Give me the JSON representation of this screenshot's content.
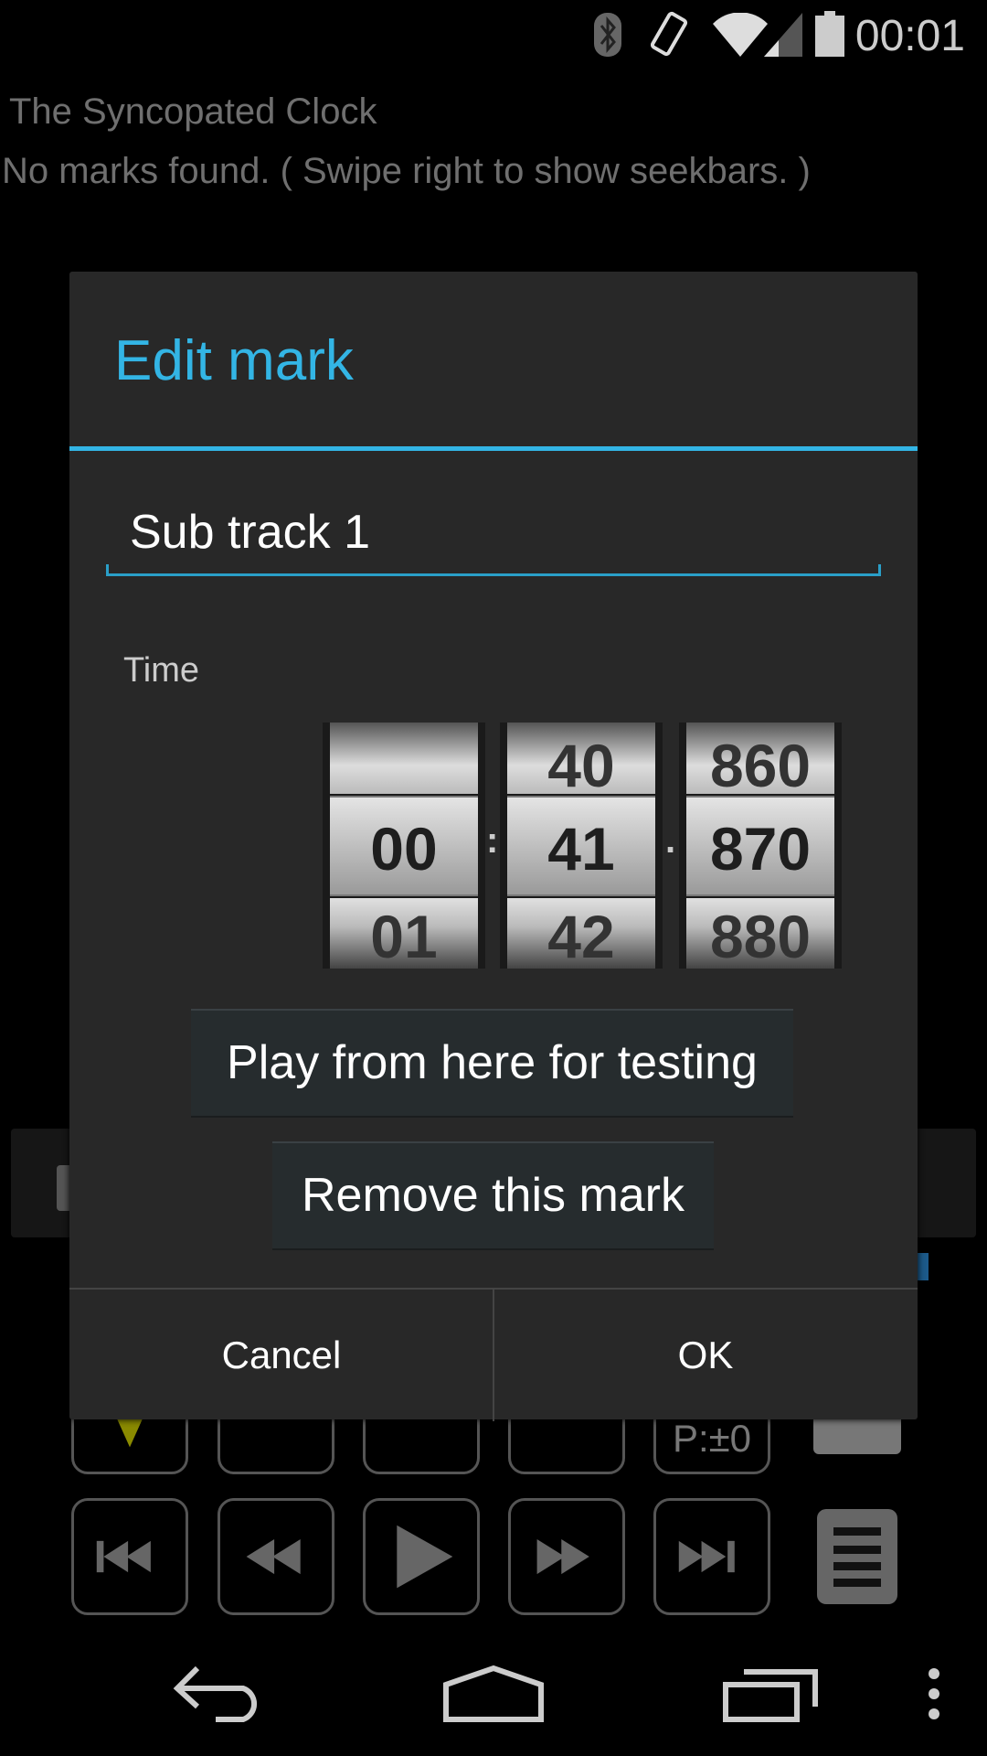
{
  "status_bar": {
    "time": "00:01",
    "icons": [
      "bluetooth-icon",
      "rotation-icon",
      "wifi-icon",
      "signal-icon",
      "battery-icon"
    ]
  },
  "app": {
    "title": "The Syncopated Clock",
    "message": "No marks found. ( Swipe right to show seekbars. )"
  },
  "controls": {
    "pitch_label": "P:±0",
    "row1": [
      "yellow-marker",
      "prev-mark",
      "mark",
      "next-mark",
      "pitch",
      "edit"
    ],
    "row2": [
      "skip-start",
      "rewind",
      "play",
      "fast-forward",
      "skip-end",
      "menu"
    ]
  },
  "dialog": {
    "title": "Edit mark",
    "name_value": "Sub track 1",
    "time_label": "Time",
    "time": {
      "hours": {
        "prev": "",
        "current": "00",
        "next": "01"
      },
      "minutes": {
        "prev": "40",
        "current": "41",
        "next": "42"
      },
      "millis": {
        "prev": "860",
        "current": "870",
        "next": "880"
      },
      "sep1": ":",
      "sep2": "."
    },
    "play_button": "Play from here for testing",
    "remove_button": "Remove this mark",
    "cancel": "Cancel",
    "ok": "OK"
  },
  "colors": {
    "accent": "#33b5e5",
    "dialog_bg": "#282828"
  }
}
